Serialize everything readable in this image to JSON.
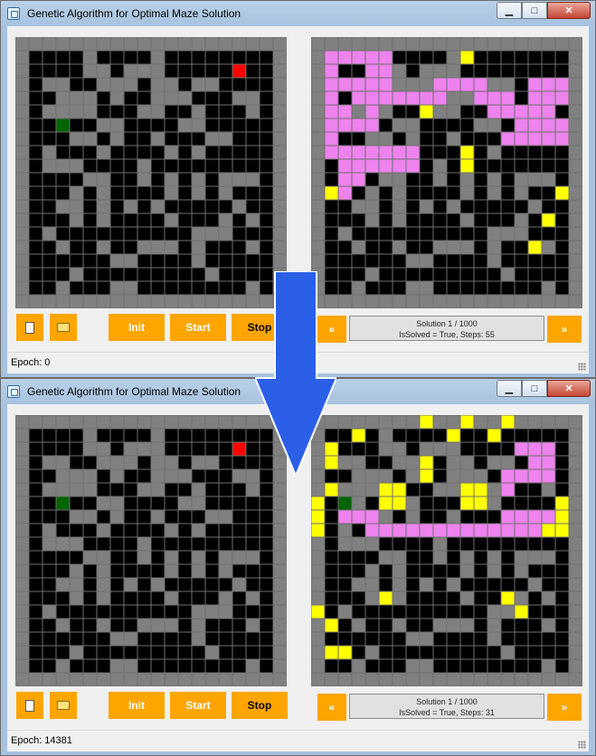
{
  "colors": {
    "wall": "#000000",
    "path": "#808080",
    "grid_line": "#707070",
    "start": "#006400",
    "goal": "#ff0000",
    "solution": "#ee82ee",
    "visited": "#ffff00",
    "button": "#ffa500",
    "arrow": "#2b5fe8"
  },
  "windows": [
    {
      "title": "Genetic Algorithm for Optimal Maze Solution",
      "buttons": {
        "init": "Init",
        "start": "Start",
        "stop": "Stop",
        "prev": "«",
        "next": "»"
      },
      "info": {
        "line1": "Solution 1 / 1000",
        "line2": "IsSolved = True, Steps: 55"
      },
      "status": "Epoch: 0",
      "right_maze_state": "initial"
    },
    {
      "title": "Genetic Algorithm for Optimal Maze Solution",
      "buttons": {
        "init": "Init",
        "start": "Start",
        "stop": "Stop",
        "prev": "«",
        "next": "»"
      },
      "info": {
        "line1": "Solution 1 / 1000",
        "line2": "IsSolved = True, Steps: 31"
      },
      "status": "Epoch: 14381",
      "right_maze_state": "solved"
    }
  ],
  "maze": {
    "rows": 20,
    "cols": 20,
    "walls": [
      "GGGGGGGGGGGGGGGGGGGG",
      "GBBBBGBBBBGBBBBBBBBG",
      "GBBBBGGBGGGBBBBBBBBG",
      "GBGGBBGGGBGGBGGBBBBG",
      "GBBGGGBGBBGGGBBBGGBG",
      "GBGGGGBBBGGBBGBBBGBG",
      "GBBGBBGGBBBBGGBBBBBG",
      "GBBBGGBGBBGBBBGGBBBG",
      "GBGBBBGBBBBGBGBBBBBG",
      "GBGGGBBBBGBBBBBBBBBG",
      "GBBBBGGBBGBGBGBGGGBG",
      "GBBBGBGBBBBGBGBGBBBG",
      "GBBGGBGBGBGBBBBBGBBG",
      "GBBBGBGBBBBGBBBGBGBG",
      "GBGBBBBBBBBBBGGGBBBG",
      "GBBGBBGBBGGGBGBBBGBG",
      "GBBBBBBGGBBBBGBBBBBG",
      "GBBBGBBBBBBBBBGBBBBG",
      "GBBGBBBGGBBBBBBBBGBG",
      "GGGGGGGGGGGGGGGGGGGG"
    ],
    "start": [
      6,
      3
    ],
    "goal": [
      2,
      16
    ]
  },
  "right_initial": {
    "solution": [
      [
        1,
        1
      ],
      [
        1,
        2
      ],
      [
        1,
        3
      ],
      [
        1,
        4
      ],
      [
        1,
        5
      ],
      [
        2,
        1
      ],
      [
        2,
        4
      ],
      [
        2,
        5
      ],
      [
        3,
        1
      ],
      [
        3,
        2
      ],
      [
        3,
        3
      ],
      [
        3,
        4
      ],
      [
        3,
        5
      ],
      [
        3,
        9
      ],
      [
        3,
        10
      ],
      [
        3,
        11
      ],
      [
        3,
        12
      ],
      [
        3,
        16
      ],
      [
        3,
        17
      ],
      [
        3,
        18
      ],
      [
        4,
        1
      ],
      [
        4,
        3
      ],
      [
        4,
        4
      ],
      [
        4,
        5
      ],
      [
        4,
        6
      ],
      [
        4,
        7
      ],
      [
        4,
        8
      ],
      [
        4,
        9
      ],
      [
        4,
        12
      ],
      [
        4,
        13
      ],
      [
        4,
        14
      ],
      [
        4,
        16
      ],
      [
        4,
        17
      ],
      [
        4,
        18
      ],
      [
        5,
        1
      ],
      [
        5,
        2
      ],
      [
        5,
        4
      ],
      [
        5,
        13
      ],
      [
        5,
        14
      ],
      [
        5,
        15
      ],
      [
        5,
        16
      ],
      [
        5,
        17
      ],
      [
        6,
        1
      ],
      [
        6,
        2
      ],
      [
        6,
        3
      ],
      [
        6,
        4
      ],
      [
        6,
        15
      ],
      [
        6,
        16
      ],
      [
        6,
        17
      ],
      [
        6,
        18
      ],
      [
        7,
        1
      ],
      [
        7,
        14
      ],
      [
        7,
        15
      ],
      [
        7,
        16
      ],
      [
        7,
        17
      ],
      [
        7,
        18
      ],
      [
        8,
        1
      ],
      [
        8,
        2
      ],
      [
        8,
        3
      ],
      [
        8,
        4
      ],
      [
        8,
        5
      ],
      [
        8,
        6
      ],
      [
        8,
        7
      ],
      [
        9,
        2
      ],
      [
        9,
        3
      ],
      [
        9,
        4
      ],
      [
        9,
        5
      ],
      [
        9,
        6
      ],
      [
        9,
        7
      ],
      [
        10,
        2
      ],
      [
        10,
        3
      ],
      [
        11,
        2
      ]
    ],
    "visited": [
      [
        1,
        11
      ],
      [
        5,
        8
      ],
      [
        8,
        11
      ],
      [
        9,
        11
      ],
      [
        11,
        1
      ],
      [
        15,
        16
      ],
      [
        11,
        18
      ],
      [
        13,
        17
      ]
    ]
  },
  "right_solved": {
    "solution": [
      [
        2,
        15
      ],
      [
        2,
        16
      ],
      [
        2,
        17
      ],
      [
        3,
        16
      ],
      [
        3,
        17
      ],
      [
        4,
        14
      ],
      [
        4,
        15
      ],
      [
        4,
        16
      ],
      [
        4,
        17
      ],
      [
        5,
        14
      ],
      [
        6,
        2
      ],
      [
        7,
        2
      ],
      [
        7,
        3
      ],
      [
        7,
        4
      ],
      [
        7,
        14
      ],
      [
        7,
        15
      ],
      [
        7,
        16
      ],
      [
        7,
        17
      ],
      [
        8,
        4
      ],
      [
        8,
        5
      ],
      [
        8,
        6
      ],
      [
        8,
        7
      ],
      [
        8,
        8
      ],
      [
        8,
        9
      ],
      [
        8,
        10
      ],
      [
        8,
        11
      ],
      [
        8,
        12
      ],
      [
        8,
        13
      ],
      [
        8,
        14
      ],
      [
        8,
        15
      ],
      [
        8,
        16
      ]
    ],
    "visited": [
      [
        0,
        8
      ],
      [
        0,
        11
      ],
      [
        0,
        14
      ],
      [
        1,
        3
      ],
      [
        1,
        10
      ],
      [
        1,
        13
      ],
      [
        2,
        1
      ],
      [
        3,
        1
      ],
      [
        3,
        8
      ],
      [
        4,
        8
      ],
      [
        5,
        1
      ],
      [
        5,
        5
      ],
      [
        5,
        6
      ],
      [
        5,
        11
      ],
      [
        5,
        12
      ],
      [
        6,
        5
      ],
      [
        6,
        6
      ],
      [
        6,
        11
      ],
      [
        6,
        12
      ],
      [
        6,
        0
      ],
      [
        7,
        0
      ],
      [
        8,
        0
      ],
      [
        6,
        18
      ],
      [
        7,
        18
      ],
      [
        8,
        17
      ],
      [
        8,
        18
      ],
      [
        13,
        5
      ],
      [
        13,
        14
      ],
      [
        14,
        0
      ],
      [
        14,
        15
      ],
      [
        15,
        1
      ],
      [
        17,
        1
      ],
      [
        17,
        2
      ]
    ],
    "start": [
      6,
      2
    ]
  }
}
